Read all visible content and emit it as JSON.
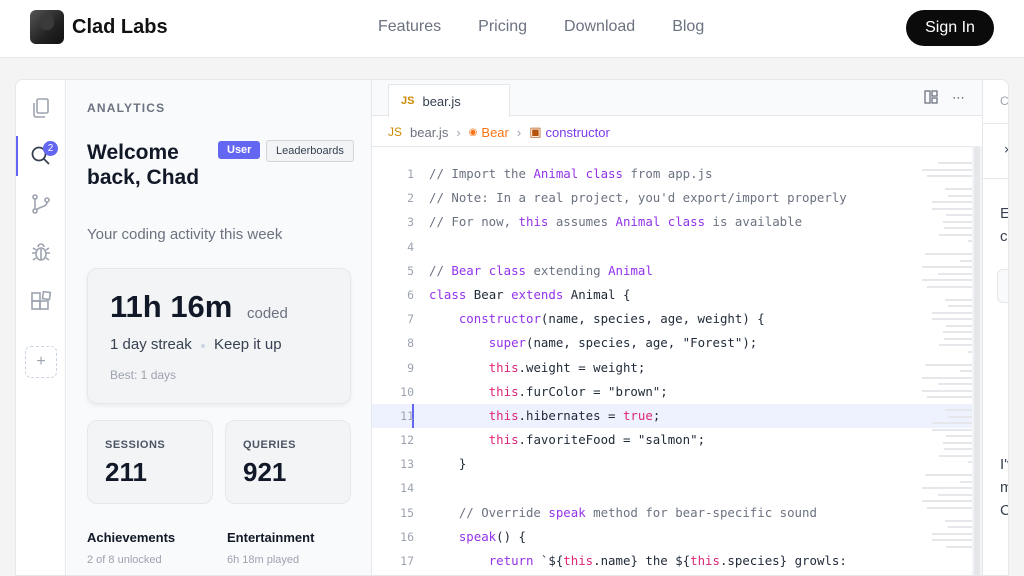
{
  "nav": {
    "brand": "Clad Labs",
    "links": [
      "Features",
      "Pricing",
      "Download",
      "Blog"
    ],
    "signin": "Sign In"
  },
  "activity_bar": {
    "icons": [
      "files-icon",
      "search-icon",
      "source-control-icon",
      "debug-icon",
      "extensions-icon"
    ],
    "search_badge": "2",
    "add_label": "+"
  },
  "sidebar": {
    "title": "ANALYTICS",
    "welcome": "Welcome back, Chad",
    "tag_user": "User",
    "tag_leaderboards": "Leaderboards",
    "subtitle": "Your coding activity this week",
    "coded_time": "11h 16m",
    "coded_label": "coded",
    "streak": "1 day streak",
    "keep": "Keep it up",
    "best": "Best: 1 days",
    "sessions_label": "SESSIONS",
    "sessions_value": "211",
    "queries_label": "QUERIES",
    "queries_value": "921",
    "achievements_title": "Achievements",
    "achievements_sub": "2 of 8 unlocked",
    "entertainment_title": "Entertainment",
    "entertainment_sub": "6h 18m played"
  },
  "editor": {
    "tab_icon": "JS",
    "tab_name": "bear.js",
    "breadcrumb": {
      "file_icon": "JS",
      "file": "bear.js",
      "class": "Bear",
      "method": "constructor"
    },
    "highlighted_line": 11,
    "lines": [
      "// Import the Animal class from app.js",
      "// Note: In a real project, you'd export/import properly",
      "// For now, this assumes Animal class is available",
      "",
      "// Bear class extending Animal",
      "class Bear extends Animal {",
      "    constructor(name, species, age, weight) {",
      "        super(name, species, age, \"Forest\");",
      "        this.weight = weight;",
      "        this.furColor = \"brown\";",
      "        this.hibernates = true;",
      "        this.favoriteFood = \"salmon\";",
      "    }",
      "",
      "    // Override speak method for bear-specific sound",
      "    speak() {",
      "        return `${this.name} the ${this.species} growls:"
    ]
  },
  "chat": {
    "header": "CH",
    "close": "×",
    "text1": "Ex\ncl",
    "text2": "I'v\nm\nCl"
  }
}
